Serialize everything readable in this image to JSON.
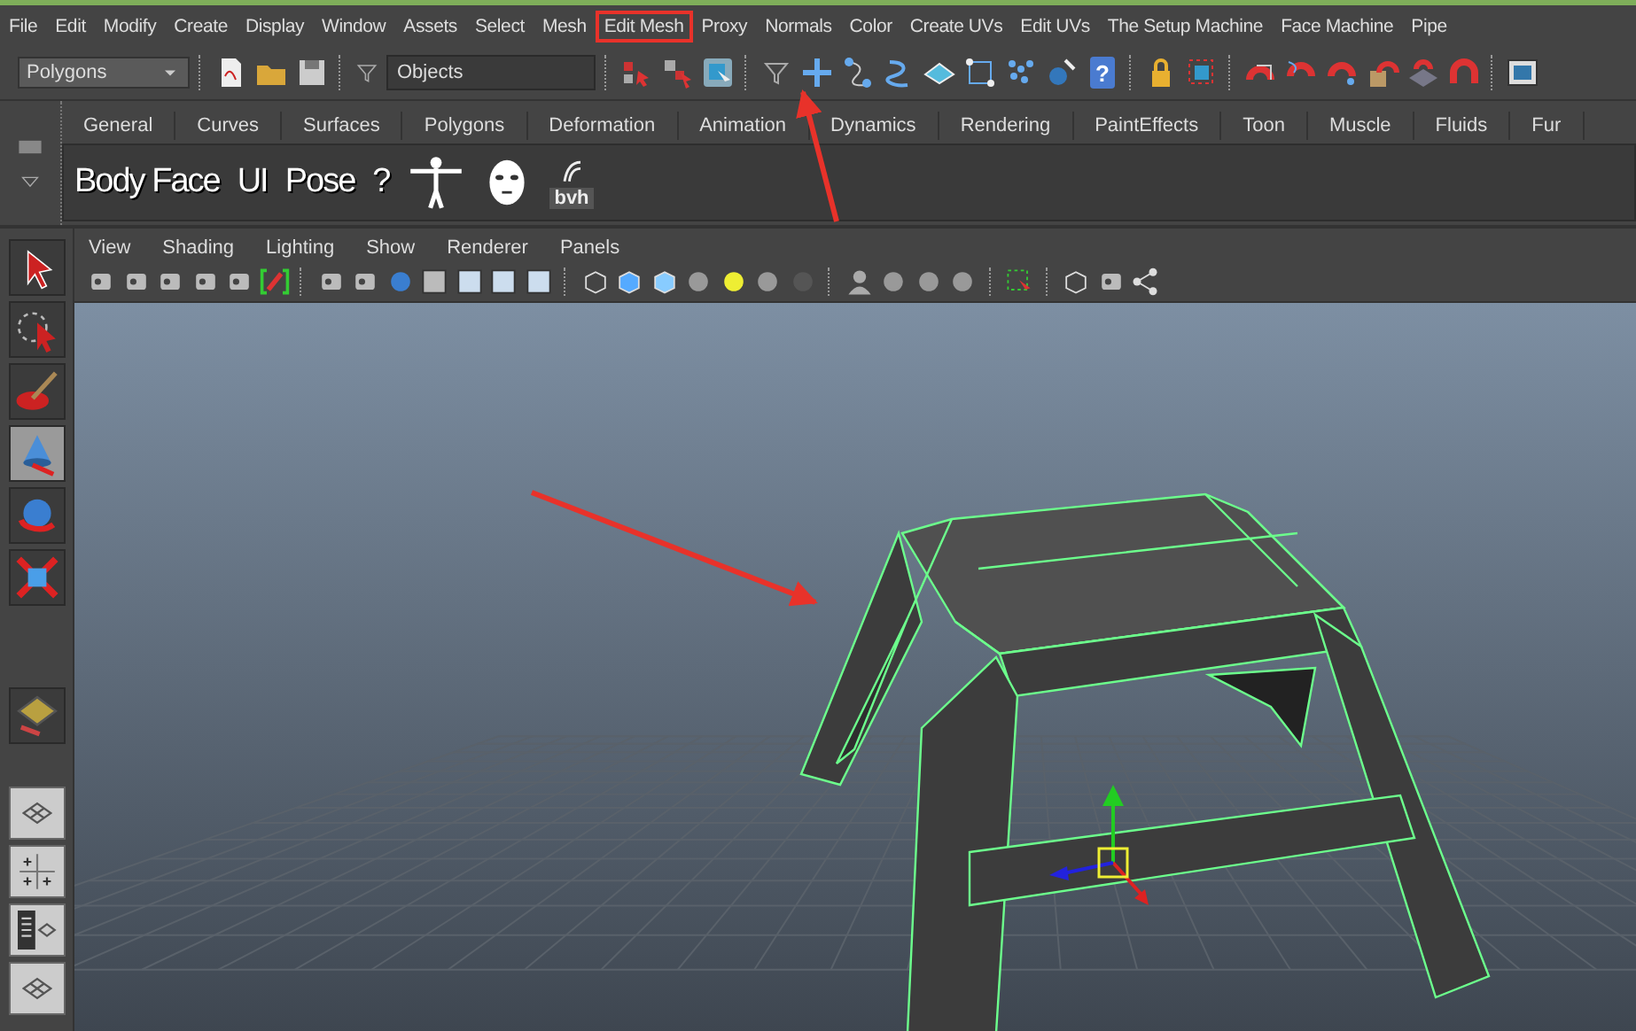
{
  "menu_bar": {
    "items": [
      {
        "label": "File",
        "highlighted": false
      },
      {
        "label": "Edit",
        "highlighted": false
      },
      {
        "label": "Modify",
        "highlighted": false
      },
      {
        "label": "Create",
        "highlighted": false
      },
      {
        "label": "Display",
        "highlighted": false
      },
      {
        "label": "Window",
        "highlighted": false
      },
      {
        "label": "Assets",
        "highlighted": false
      },
      {
        "label": "Select",
        "highlighted": false
      },
      {
        "label": "Mesh",
        "highlighted": false
      },
      {
        "label": "Edit Mesh",
        "highlighted": true
      },
      {
        "label": "Proxy",
        "highlighted": false
      },
      {
        "label": "Normals",
        "highlighted": false
      },
      {
        "label": "Color",
        "highlighted": false
      },
      {
        "label": "Create UVs",
        "highlighted": false
      },
      {
        "label": "Edit UVs",
        "highlighted": false
      },
      {
        "label": "The Setup Machine",
        "highlighted": false
      },
      {
        "label": "Face Machine",
        "highlighted": false
      },
      {
        "label": "Pipe",
        "highlighted": false
      }
    ]
  },
  "status_line": {
    "menu_set": "Polygons",
    "selection_mode": "Objects",
    "help_glyph": "?"
  },
  "shelf": {
    "tabs": [
      "General",
      "Curves",
      "Surfaces",
      "Polygons",
      "Deformation",
      "Animation",
      "Dynamics",
      "Rendering",
      "PaintEffects",
      "Toon",
      "Muscle",
      "Fluids",
      "Fur"
    ],
    "buttons": [
      "Body Face",
      "UI",
      "Pose",
      "?"
    ],
    "bvh_label": "bvh"
  },
  "toolbox": {
    "tools": [
      {
        "selected": false
      },
      {
        "selected": false
      },
      {
        "selected": false
      },
      {
        "selected": true
      },
      {
        "selected": false
      },
      {
        "selected": false
      },
      {
        "selected": false
      }
    ]
  },
  "viewport": {
    "menus": [
      "View",
      "Shading",
      "Lighting",
      "Show",
      "Renderer",
      "Panels"
    ]
  }
}
